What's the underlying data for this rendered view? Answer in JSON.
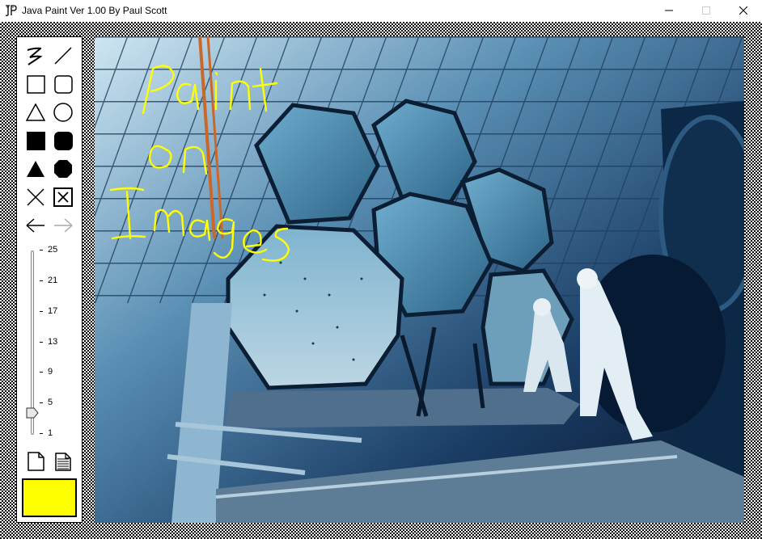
{
  "window": {
    "title": "Java Paint Ver 1.00 By Paul Scott",
    "app_icon": "jp-logo-icon",
    "controls": [
      "minimize-icon",
      "maximize-icon",
      "close-icon"
    ]
  },
  "toolbox": {
    "tools": [
      {
        "id": "freehand",
        "icon": "freehand-icon"
      },
      {
        "id": "line",
        "icon": "line-icon"
      },
      {
        "id": "rectangle",
        "icon": "rectangle-icon"
      },
      {
        "id": "rounded-rectangle",
        "icon": "rounded-rectangle-icon"
      },
      {
        "id": "triangle",
        "icon": "triangle-icon"
      },
      {
        "id": "oval",
        "icon": "oval-icon"
      },
      {
        "id": "filled-rectangle",
        "icon": "filled-rectangle-icon"
      },
      {
        "id": "filled-rounded-rectangle",
        "icon": "filled-rounded-rectangle-icon"
      },
      {
        "id": "filled-triangle",
        "icon": "filled-triangle-icon"
      },
      {
        "id": "filled-octagon",
        "icon": "filled-octagon-icon"
      },
      {
        "id": "clear-x",
        "icon": "x-icon"
      },
      {
        "id": "boxed-x",
        "icon": "boxed-x-icon"
      },
      {
        "id": "undo",
        "icon": "arrow-left-icon"
      },
      {
        "id": "redo",
        "icon": "arrow-right-icon"
      }
    ],
    "brush_size": {
      "value": 3,
      "min": 1,
      "max": 25,
      "tick_labels": [
        "25",
        "21",
        "17",
        "13",
        "9",
        "5",
        "1"
      ]
    },
    "bottom_tools": [
      {
        "id": "new",
        "icon": "new-page-icon"
      },
      {
        "id": "open",
        "icon": "open-file-icon"
      }
    ],
    "current_color": "#ffff00"
  },
  "canvas": {
    "annotation_lines": [
      "Paint",
      "on",
      "Images"
    ],
    "annotation_color": "#ffff00"
  }
}
